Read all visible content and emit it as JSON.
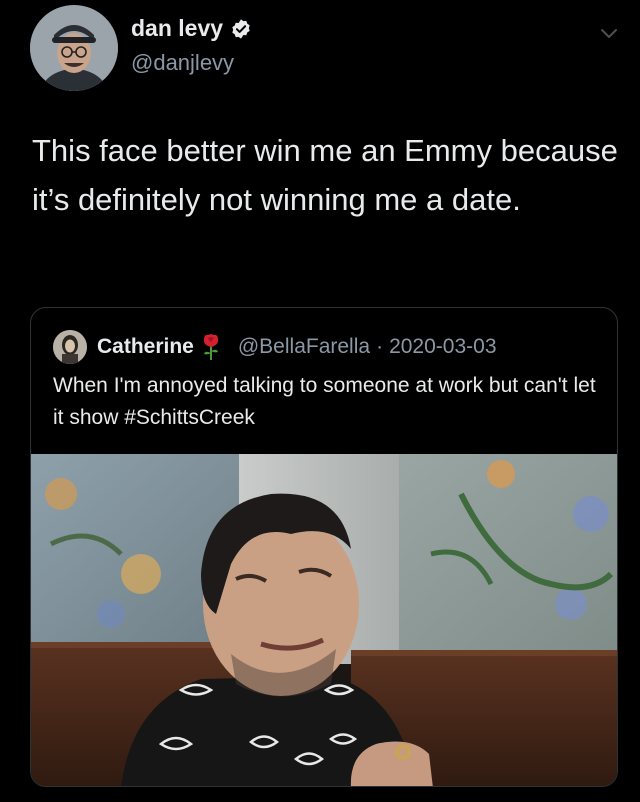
{
  "tweet": {
    "display_name": "dan levy",
    "handle": "@danjlevy",
    "text": "This face better win me an Emmy because it’s definitely not winning me a date."
  },
  "quoted_tweet": {
    "display_name": "Catherine",
    "handle": "@BellaFarella",
    "separator": "·",
    "date": "2020-03-03",
    "text": "When I'm annoyed talking to someone at work but can't let it show #SchittsCreek"
  },
  "icons": {
    "verified": "verified-badge-icon",
    "more": "chevron-down-icon",
    "name_emoji": "rose-icon"
  },
  "colors": {
    "background": "#000000",
    "text": "#e8eaec",
    "secondary_text": "#8b98a5",
    "border": "#2f3336",
    "verified": "#e8eaec"
  }
}
